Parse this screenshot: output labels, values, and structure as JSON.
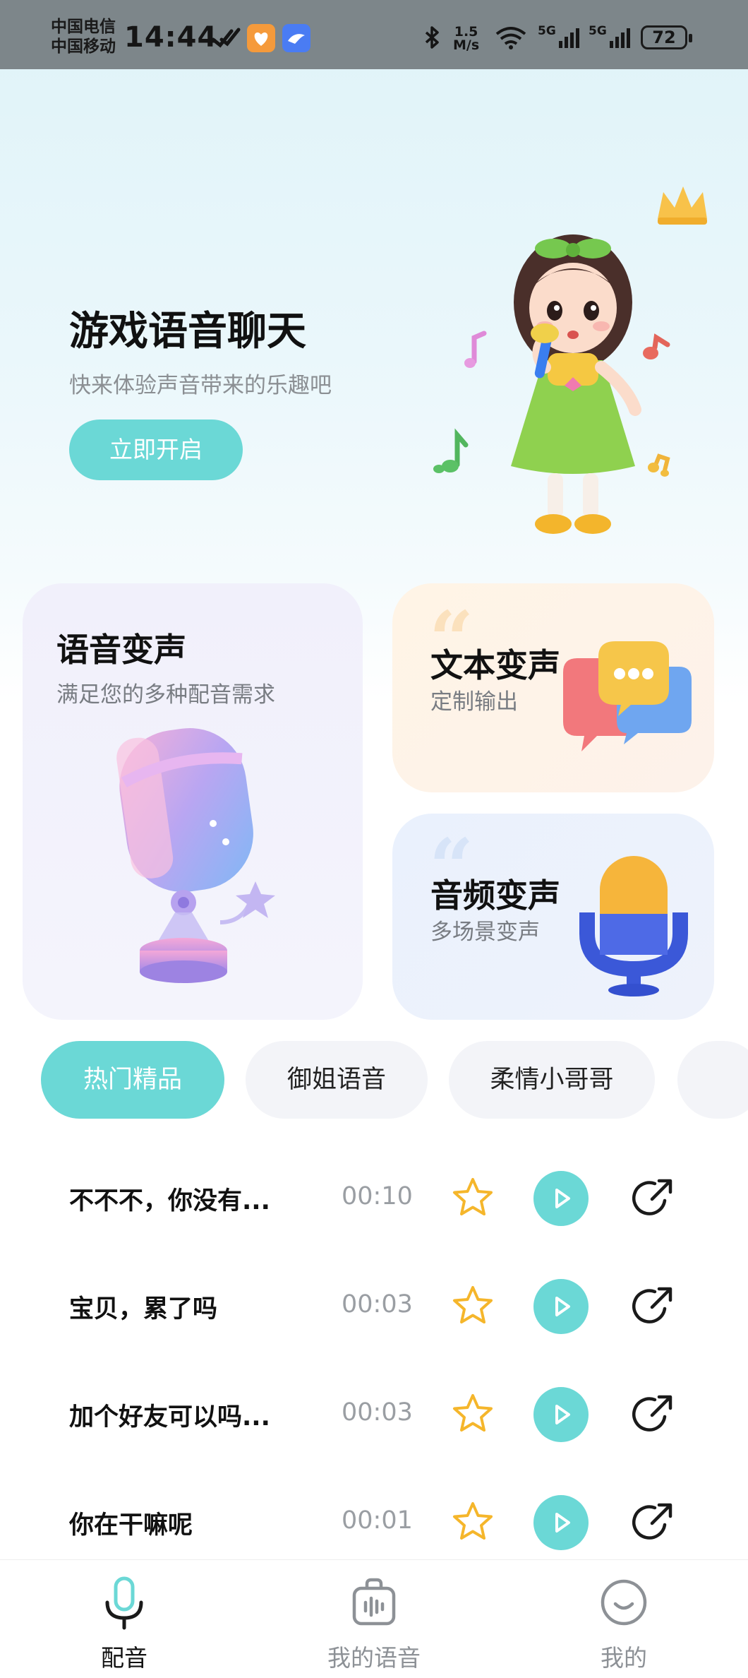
{
  "status_bar": {
    "carrier1": "中国电信",
    "carrier2": "中国移动",
    "time": "14:44",
    "net_speed_value": "1.5",
    "net_speed_unit": "M/s",
    "signal1": "5G",
    "signal2": "5G",
    "battery": "72"
  },
  "hero": {
    "title": "游戏语音聊天",
    "subtitle": "快来体验声音带来的乐趣吧",
    "button": "立即开启"
  },
  "cards": {
    "voice": {
      "title": "语音变声",
      "subtitle": "满足您的多种配音需求"
    },
    "text": {
      "title": "文本变声",
      "subtitle": "定制输出"
    },
    "audio": {
      "title": "音频变声",
      "subtitle": "多场景变声"
    }
  },
  "tabs": [
    {
      "label": "热门精品",
      "active": true
    },
    {
      "label": "御姐语音",
      "active": false
    },
    {
      "label": "柔情小哥哥",
      "active": false
    }
  ],
  "list": [
    {
      "title": "不不不，你没有...",
      "duration": "00:10"
    },
    {
      "title": "宝贝，累了吗",
      "duration": "00:03"
    },
    {
      "title": "加个好友可以吗...",
      "duration": "00:03"
    },
    {
      "title": "你在干嘛呢",
      "duration": "00:01"
    }
  ],
  "bottom_nav": [
    {
      "label": "配音",
      "icon": "microphone-icon",
      "active": true
    },
    {
      "label": "我的语音",
      "icon": "voice-bag-icon",
      "active": false
    },
    {
      "label": "我的",
      "icon": "smile-face-icon",
      "active": false
    }
  ],
  "colors": {
    "accent": "#6bd8d6",
    "star": "#f5b62b"
  }
}
